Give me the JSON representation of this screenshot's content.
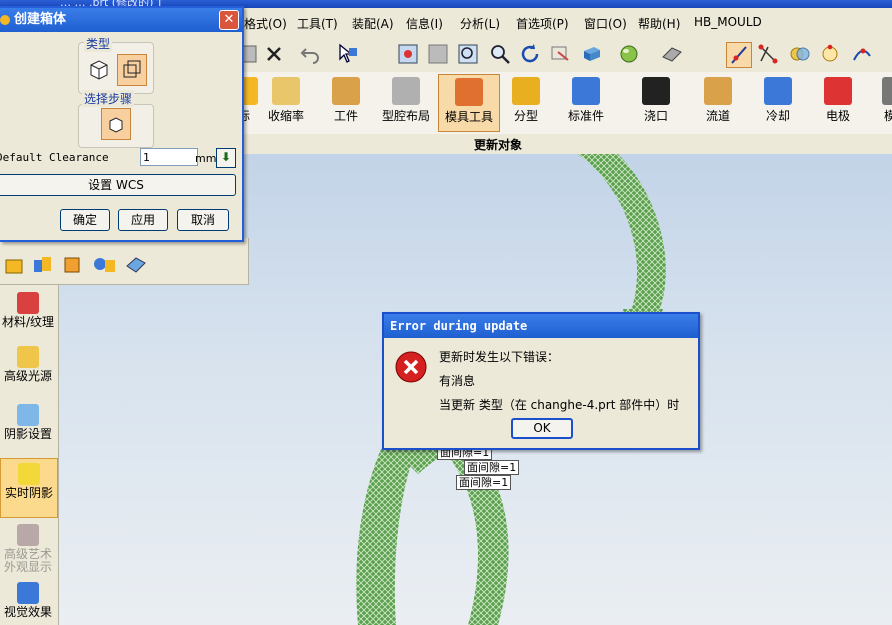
{
  "window": {
    "title_partial": "…  …  .prt  (修改的)  ]"
  },
  "menu": [
    "格式(O)",
    "工具(T)",
    "装配(A)",
    "信息(I)",
    "分析(L)",
    "首选项(P)",
    "窗口(O)",
    "帮助(H)",
    "HB_MOULD"
  ],
  "ribbon": {
    "items": [
      "标",
      "收缩率",
      "工件",
      "型腔布局",
      "模具工具",
      "分型",
      "标准件",
      "浇口",
      "流道",
      "冷却",
      "电极",
      "模具"
    ],
    "active": "模具工具"
  },
  "subbar": {
    "label": "更新对象"
  },
  "dialog": {
    "title": "创建箱体",
    "type_label": "类型",
    "step_label": "选择步骤",
    "clearance_label": "Default Clearance",
    "clearance_value": "1",
    "clearance_unit": "mm",
    "set_wcs": "设置 WCS",
    "ok": "确定",
    "apply": "应用",
    "cancel": "取消"
  },
  "left_palette": [
    {
      "label": "材料/纹理",
      "selected": false,
      "disabled": false
    },
    {
      "label": "高级光源",
      "selected": false,
      "disabled": false
    },
    {
      "label": "阴影设置",
      "selected": false,
      "disabled": false
    },
    {
      "label": "实时阴影",
      "selected": true,
      "disabled": false
    },
    {
      "label": "高级艺术外观显示",
      "selected": false,
      "disabled": true
    },
    {
      "label": "视觉效果",
      "selected": false,
      "disabled": false
    }
  ],
  "error_dialog": {
    "title": "Error during update",
    "line1": "更新时发生以下错误：",
    "line2": "有消息",
    "line3": "当更新   类型（在 changhe-4.prt 部件中）时",
    "ok": "OK"
  },
  "viewport_labels": [
    "面间隙=1",
    "面间隙=1",
    "面间隙=1"
  ],
  "colors": {
    "title_blue": "#1f5fd0",
    "model_green": "#3f8f3a",
    "error_red": "#d42020"
  }
}
